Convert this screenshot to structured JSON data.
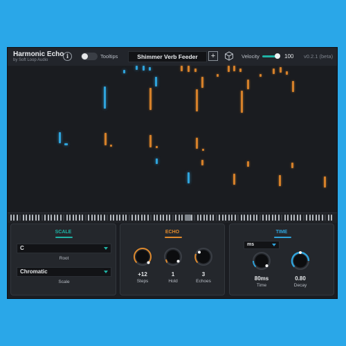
{
  "header": {
    "title": "Harmonic Echo",
    "subtitle": "by Soft Loop Audio",
    "info_icon": "info-icon",
    "tooltips_label": "Tooltips",
    "tooltips_on": false,
    "preset_name": "Shimmer Verb Feeder",
    "add_icon": "plus-icon",
    "cube_icon": "cube-icon",
    "velocity_label": "Velocity",
    "velocity_value": "100",
    "version": "v0.2.1 (beta)"
  },
  "colors": {
    "accent_teal": "#1fb3a5",
    "echo_orange": "#e08a2c",
    "note_blue": "#2fa3db",
    "background": "#1b1d22"
  },
  "scale": {
    "title": "SCALE",
    "root_value": "C",
    "root_label": "Root",
    "scale_value": "Chromatic",
    "scale_label": "Scale"
  },
  "echo": {
    "title": "ECHO",
    "steps_value": "+12",
    "steps_label": "Steps",
    "hold_value": "1",
    "hold_label": "Hold",
    "echoes_value": "3",
    "echoes_label": "Echoes"
  },
  "time": {
    "title": "TIME",
    "unit_value": "ms",
    "time_value": "80ms",
    "time_label": "Time",
    "decay_value": "0.80",
    "decay_label": "Decay"
  }
}
